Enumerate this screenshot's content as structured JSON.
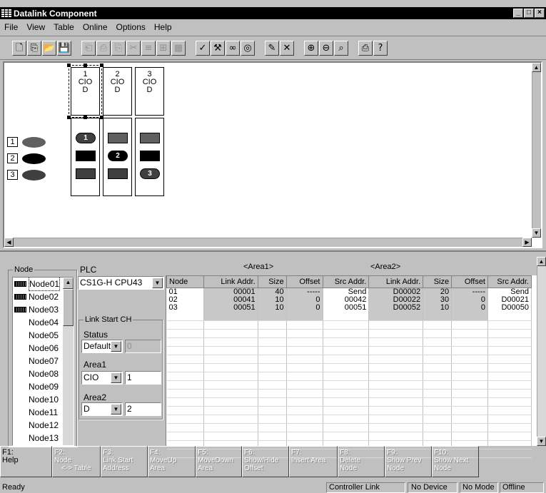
{
  "window": {
    "title": "Datalink Component"
  },
  "menu": [
    "File",
    "View",
    "Table",
    "Online",
    "Options",
    "Help"
  ],
  "toolbar": {
    "icons": [
      "new-icon",
      "new-from-icon",
      "open-icon",
      "save-icon",
      "copy-icon",
      "paste-icon",
      "paste-special-icon",
      "cut-icon",
      "align-icon",
      "group-icon",
      "grid-icon",
      "check-icon",
      "wizard-icon",
      "link-icon",
      "target-icon",
      "brush-icon",
      "delete-icon",
      "zoom-in-icon",
      "zoom-out-icon",
      "zoom-fit-icon",
      "print-icon",
      "help-icon"
    ]
  },
  "diagram": {
    "headers": [
      {
        "num": "1",
        "l1": "CIO",
        "l2": "D"
      },
      {
        "num": "2",
        "l1": "CIO",
        "l2": "D"
      },
      {
        "num": "3",
        "l1": "CIO",
        "l2": "D"
      }
    ],
    "rows": [
      "1",
      "2",
      "3"
    ],
    "marks": [
      "1",
      "2",
      "3"
    ]
  },
  "node_panel": {
    "legend": "Node",
    "items": [
      "Node01",
      "Node02",
      "Node03",
      "Node04",
      "Node05",
      "Node06",
      "Node07",
      "Node08",
      "Node09",
      "Node10",
      "Node11",
      "Node12",
      "Node13"
    ]
  },
  "plc": {
    "label": "PLC",
    "value": "CS1G-H CPU43",
    "link_start_legend": "Link Start CH",
    "status_label": "Status",
    "status_value": "Default",
    "status_field": "0",
    "area1_label": "Area1",
    "area1_value": "CIO",
    "area1_field": "1",
    "area2_label": "Area2",
    "area2_value": "D",
    "area2_field": "2"
  },
  "grid": {
    "area1_header": "<Area1>",
    "area2_header": "<Area2>",
    "columns": [
      "Node",
      "Link Addr.",
      "Size",
      "Offset",
      "Src Addr.",
      "Link Addr.",
      "Size",
      "Offset",
      "Src Addr."
    ],
    "rows": [
      [
        "01",
        "00001",
        "40",
        "-----",
        "Send",
        "D00002",
        "20",
        "-----",
        "Send"
      ],
      [
        "02",
        "00041",
        "10",
        "0",
        "00042",
        "D00022",
        "30",
        "0",
        "D00021"
      ],
      [
        "03",
        "00051",
        "10",
        "0",
        "00051",
        "D00052",
        "10",
        "0",
        "D00050"
      ]
    ]
  },
  "fkeys": [
    {
      "l1": "F1:",
      "l2": "Help",
      "l3": "",
      "enabled": true
    },
    {
      "l1": "F2:",
      "l2": "Node",
      "l3": "<-> Table",
      "enabled": false
    },
    {
      "l1": "F3:",
      "l2": "Link Start",
      "l3": "Address",
      "enabled": false
    },
    {
      "l1": "F4:",
      "l2": "MoveUp",
      "l3": "Area",
      "enabled": false
    },
    {
      "l1": "F5:",
      "l2": "MoveDown",
      "l3": "Area",
      "enabled": false
    },
    {
      "l1": "F6:",
      "l2": "Show/Hide",
      "l3": "Offset",
      "enabled": false
    },
    {
      "l1": "F7:",
      "l2": "Insert Area",
      "l3": "",
      "enabled": false
    },
    {
      "l1": "F8:",
      "l2": "Delete",
      "l3": "Node",
      "enabled": false
    },
    {
      "l1": "F9:",
      "l2": "Show Prev",
      "l3": "Node",
      "enabled": false
    },
    {
      "l1": "F10:",
      "l2": "Show Next",
      "l3": "Node",
      "enabled": false
    }
  ],
  "status": {
    "ready": "Ready",
    "link": "Controller Link",
    "device": "No Device",
    "mode": "No Mode",
    "online": "Offline"
  }
}
